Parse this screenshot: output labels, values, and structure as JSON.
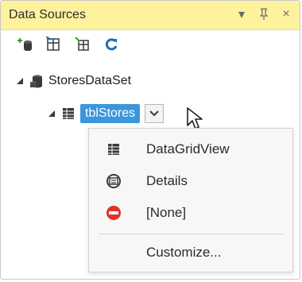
{
  "window": {
    "title": "Data Sources",
    "title_actions": [
      {
        "name": "dropdown-arrow-icon",
        "glyph": "▾"
      },
      {
        "name": "pin-icon",
        "glyph": "⊥"
      },
      {
        "name": "close-icon",
        "glyph": "×"
      }
    ],
    "title_bg": "#fff29d"
  },
  "toolbar": {
    "items": [
      {
        "name": "add-new-data-source-icon"
      },
      {
        "name": "edit-dataset-icon"
      },
      {
        "name": "configure-dataset-icon"
      },
      {
        "name": "refresh-icon"
      }
    ]
  },
  "tree": {
    "root": {
      "label": "StoresDataSet",
      "icon": "dataset-icon"
    },
    "child": {
      "label": "tblStores",
      "icon": "datagrid-icon",
      "selected": true
    }
  },
  "menu": {
    "items": [
      {
        "label": "DataGridView",
        "icon": "datagrid-icon"
      },
      {
        "label": "Details",
        "icon": "details-icon"
      },
      {
        "label": "[None]",
        "icon": "none-icon"
      },
      {
        "label": "Customize...",
        "icon": ""
      }
    ]
  },
  "colors": {
    "selection": "#3a96dd",
    "accent_blue": "#1e6ab8",
    "green": "#3e9c35",
    "red": "#e0322a"
  }
}
